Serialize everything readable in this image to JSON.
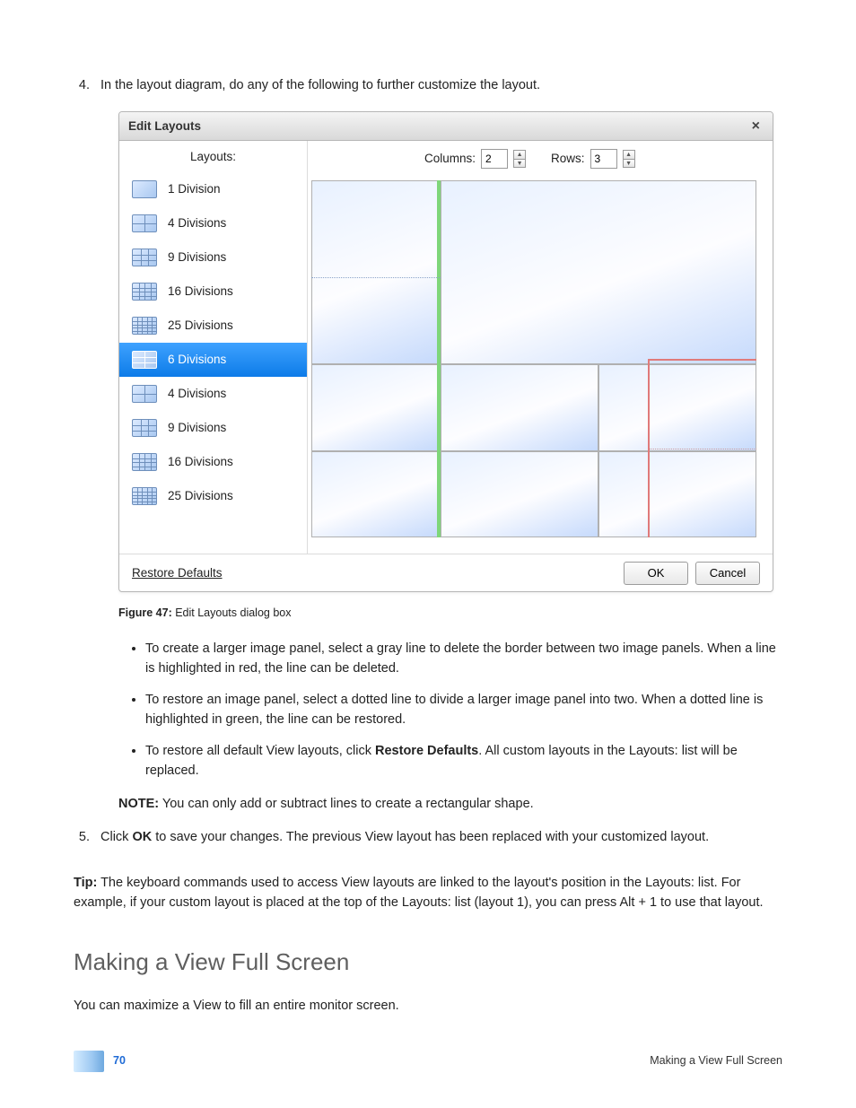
{
  "steps": {
    "step4": "In the layout diagram, do any of the following to further customize the layout.",
    "step5_pre": "Click ",
    "step5_bold": "OK",
    "step5_post": " to save your changes. The previous View layout has been replaced with your customized layout."
  },
  "dialog": {
    "title": "Edit Layouts",
    "close_glyph": "×",
    "layouts_header": "Layouts:",
    "items": [
      {
        "label": "1 Division"
      },
      {
        "label": "4 Divisions"
      },
      {
        "label": "9 Divisions"
      },
      {
        "label": "16 Divisions"
      },
      {
        "label": "25 Divisions"
      },
      {
        "label": "6 Divisions"
      },
      {
        "label": "4 Divisions"
      },
      {
        "label": "9 Divisions"
      },
      {
        "label": "16 Divisions"
      },
      {
        "label": "25 Divisions"
      }
    ],
    "columns_label": "Columns:",
    "columns_value": "2",
    "rows_label": "Rows:",
    "rows_value": "3",
    "restore": "Restore Defaults",
    "ok": "OK",
    "cancel": "Cancel"
  },
  "figure": {
    "label": "Figure 47:",
    "caption": " Edit Layouts dialog box"
  },
  "bullets": {
    "b1": "To create a larger image panel, select a gray line to delete the border between two image panels. When a line is highlighted in red, the line can be deleted.",
    "b2": "To restore an image panel, select a dotted line to divide a larger image panel into two. When a dotted line is highlighted in green, the line can be restored.",
    "b3_pre": "To restore all default View layouts, click ",
    "b3_bold": "Restore Defaults",
    "b3_post": ". All custom layouts in the Layouts: list will be replaced."
  },
  "note": {
    "label": "NOTE:",
    "text": " You can only add or subtract lines to create a rectangular shape."
  },
  "tip": {
    "label": "Tip:",
    "text": " The keyboard commands used to access View layouts are linked to the layout's position in the Layouts: list. For example, if your custom layout is placed at the top of the Layouts: list (layout 1), you can press Alt + 1 to use that layout."
  },
  "heading": "Making a View Full Screen",
  "heading_body": "You can maximize a View to fill an entire monitor screen.",
  "footer": {
    "page": "70",
    "section": "Making a View Full Screen"
  }
}
